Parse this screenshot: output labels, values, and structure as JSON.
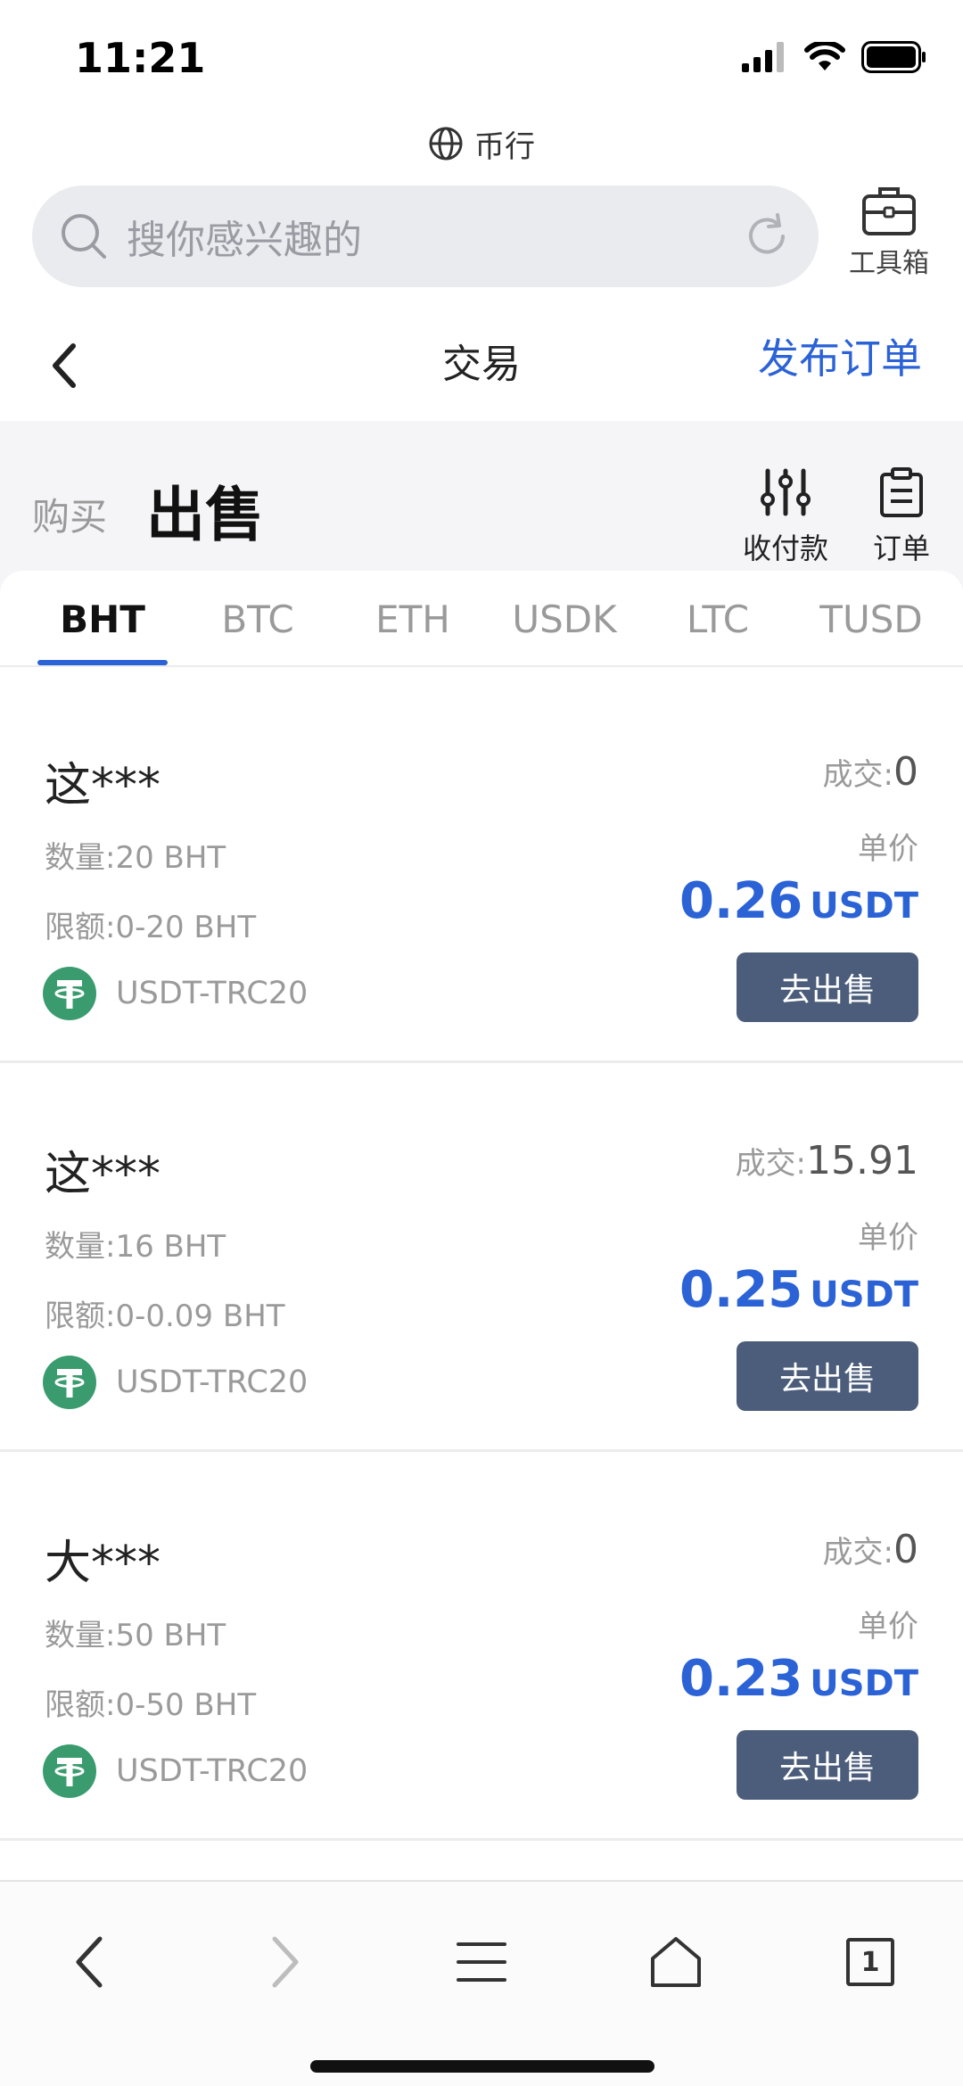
{
  "status_bar": {
    "time": "11:21"
  },
  "site": {
    "label": "币行",
    "icon": "globe-icon"
  },
  "search": {
    "placeholder": "搜你感兴趣的",
    "toolbox_label": "工具箱"
  },
  "nav": {
    "title": "交易",
    "publish_label": "发布订单"
  },
  "mode_tabs": {
    "buy": "购买",
    "sell": "出售"
  },
  "tools": {
    "payment": "收付款",
    "orders": "订单"
  },
  "coin_tabs": [
    "BHT",
    "BTC",
    "ETH",
    "USDK",
    "LTC",
    "TUSD"
  ],
  "active_coin_tab": "BHT",
  "listings": [
    {
      "seller": "这***",
      "quantity": "数量:20 BHT",
      "limit": "限额:0-20 BHT",
      "network": "USDT-TRC20",
      "deals_label": "成交:",
      "deals_value": "0",
      "unit_price_label": "单价",
      "price": "0.26",
      "price_unit": "USDT",
      "button": "去出售"
    },
    {
      "seller": "这***",
      "quantity": "数量:16 BHT",
      "limit": "限额:0-0.09 BHT",
      "network": "USDT-TRC20",
      "deals_label": "成交:",
      "deals_value": "15.91",
      "unit_price_label": "单价",
      "price": "0.25",
      "price_unit": "USDT",
      "button": "去出售"
    },
    {
      "seller": "大***",
      "quantity": "数量:50 BHT",
      "limit": "限额:0-50 BHT",
      "network": "USDT-TRC20",
      "deals_label": "成交:",
      "deals_value": "0",
      "unit_price_label": "单价",
      "price": "0.23",
      "price_unit": "USDT",
      "button": "去出售"
    }
  ],
  "bottom_bar": {
    "tabs_count": "1"
  },
  "colors": {
    "accent": "#2b63d6",
    "button": "#4b5d7a",
    "tether": "#3a9c6e"
  }
}
